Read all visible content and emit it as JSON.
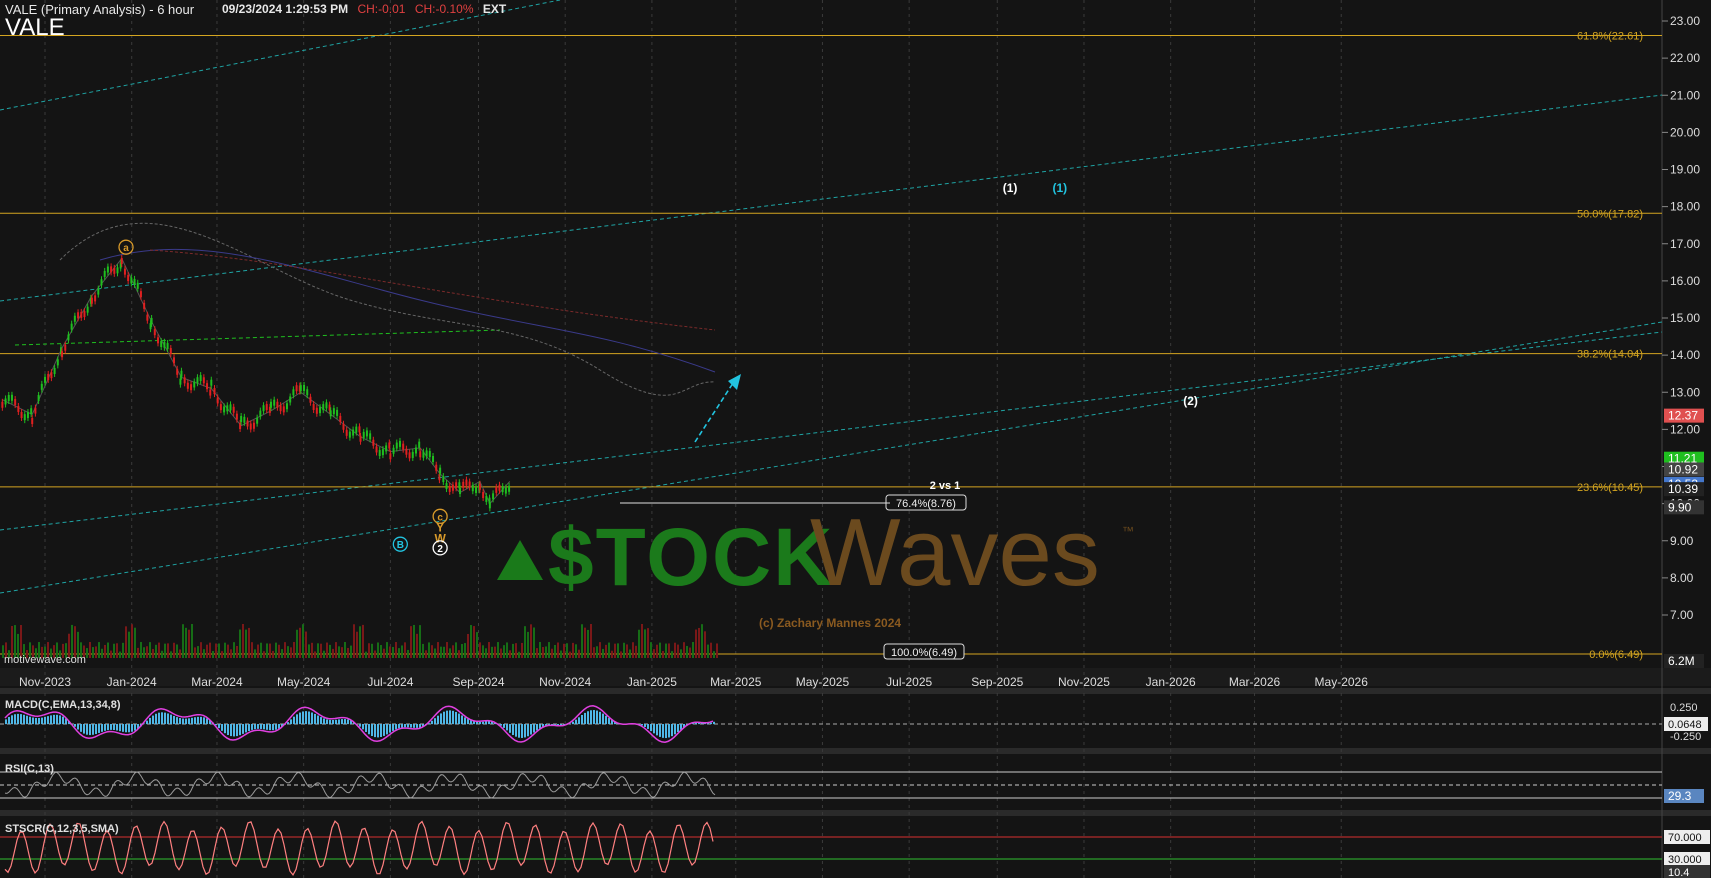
{
  "header": {
    "title": "VALE (Primary Analysis)",
    "interval": "- 6 hour",
    "datetime": "09/23/2024 1:29:53 PM",
    "change": "CH:-0.01",
    "change_pct": "CH:-0.10%",
    "session": "EXT",
    "symbol": "VALE"
  },
  "colors": {
    "background": "#141414",
    "fib": "#d4a520",
    "channel": "#1fa3a3",
    "bull_candle": "#1fbf1f",
    "bear_candle": "#e02020",
    "wave_orange": "#d89a2a",
    "wave_cyan": "#22c4e0",
    "macd_line": "#e040e0",
    "macd_hist": "#4fb8e8",
    "stoch_line": "#ff8080"
  },
  "chart_data": [
    {
      "type": "line",
      "title": "VALE (Primary Analysis)",
      "ylim": [
        6.2,
        23.4
      ],
      "yticks": [
        "23.00",
        "22.00",
        "21.00",
        "20.00",
        "19.00",
        "18.00",
        "17.00",
        "16.00",
        "15.00",
        "14.00",
        "13.00",
        "12.00",
        "11.00",
        "10.00",
        "9.00",
        "8.00",
        "7.00"
      ],
      "xticks": [
        "Nov-2023",
        "Jan-2024",
        "Mar-2024",
        "May-2024",
        "Jul-2024",
        "Sep-2024",
        "Nov-2024",
        "Jan-2025",
        "Mar-2025",
        "May-2025",
        "Jul-2025",
        "Sep-2025",
        "Nov-2025",
        "Jan-2026",
        "Mar-2026",
        "May-2026"
      ],
      "x": [
        "2023-10-02",
        "2023-10-23",
        "2023-11-13",
        "2023-12-04",
        "2023-12-25",
        "2024-01-15",
        "2024-02-05",
        "2024-02-26",
        "2024-03-18",
        "2024-04-08",
        "2024-04-29",
        "2024-05-20",
        "2024-06-10",
        "2024-07-01",
        "2024-07-22",
        "2024-08-05",
        "2024-08-19",
        "2024-09-02",
        "2024-09-09",
        "2024-09-23"
      ],
      "close": [
        12.8,
        12.4,
        14.2,
        15.6,
        16.6,
        14.9,
        13.4,
        13.1,
        12.1,
        12.5,
        13.0,
        12.4,
        11.8,
        11.4,
        11.5,
        10.8,
        10.3,
        10.6,
        10.0,
        10.6
      ],
      "fib_levels": [
        {
          "label": "61.8%(22.61)",
          "value": 22.61
        },
        {
          "label": "50.0%(17.82)",
          "value": 17.82
        },
        {
          "label": "38.2%(14.04)",
          "value": 14.04
        },
        {
          "label": "23.6%(10.45)",
          "value": 10.45
        },
        {
          "label": "0.0%(6.49)",
          "value": 6.49
        }
      ],
      "retracement_labels": [
        {
          "label": "76.4%(8.76)",
          "value": 8.76
        },
        {
          "label": "100.0%(6.49)",
          "value": 6.49
        }
      ],
      "price_tags": [
        {
          "label": "12.37",
          "value": 12.37,
          "color": "#e05050"
        },
        {
          "label": "11.21",
          "value": 11.21,
          "color": "#1fbf1f"
        },
        {
          "label": "10.92",
          "value": 10.92,
          "color": "#444444"
        },
        {
          "label": "10.53",
          "value": 10.53,
          "color": "#4477cc"
        },
        {
          "label": "10.39",
          "value": 10.39,
          "color": "#222222"
        },
        {
          "label": "9.90",
          "value": 9.9,
          "color": "#333333"
        },
        {
          "label": "6.2M",
          "value": 6.2,
          "color": "#222222"
        }
      ],
      "wave_labels": [
        {
          "text": "a",
          "date": "2023-12-28",
          "value": 16.8,
          "color": "#d89a2a",
          "circle": true
        },
        {
          "text": "c",
          "date": "2024-08-05",
          "value": 9.55,
          "color": "#d89a2a",
          "circle": true
        },
        {
          "text": "Y",
          "date": "2024-08-05",
          "value": 9.25,
          "color": "#d89a2a",
          "circle": false
        },
        {
          "text": "W",
          "date": "2024-08-05",
          "value": 8.95,
          "color": "#d89a2a",
          "circle": false
        },
        {
          "text": "2",
          "date": "2024-08-05",
          "value": 8.7,
          "color": "#ffffff",
          "circle": true
        },
        {
          "text": "B",
          "date": "2024-07-08",
          "value": 8.8,
          "color": "#22c4e0",
          "circle": true
        },
        {
          "text": "(1)",
          "date": "2025-09-10",
          "value": 18.4,
          "color": "#ffffff",
          "circle": false
        },
        {
          "text": "(1)",
          "date": "2025-10-15",
          "value": 18.4,
          "color": "#22c4e0",
          "circle": false
        },
        {
          "text": "(2)",
          "date": "2026-01-15",
          "value": 12.65,
          "color": "#ffffff",
          "circle": false
        }
      ],
      "annotation": "2 vs 1",
      "volume_label": "motivewave.com"
    },
    {
      "type": "line",
      "title": "MACD(C,EMA,13,34,8)",
      "yticks": [
        "0.250",
        "-0.250"
      ],
      "current": "0.0648"
    },
    {
      "type": "line",
      "title": "RSI(C,13)",
      "current": "29.3",
      "levels": [
        "70",
        "30"
      ]
    },
    {
      "type": "line",
      "title": "STSCR(C,12,3,5,SMA)",
      "levels": [
        "70.000",
        "30.000"
      ],
      "current": "10.4"
    }
  ],
  "watermark": {
    "brand_left": "$TOCK",
    "brand_right": "Waves",
    "tm": "™",
    "copyright": "(c) Zachary Mannes 2024"
  }
}
